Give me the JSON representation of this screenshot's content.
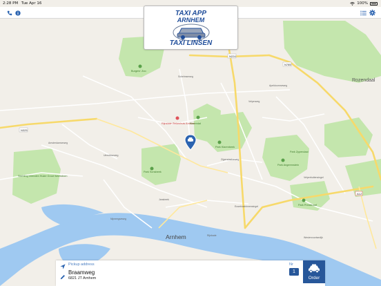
{
  "status_bar": {
    "time": "2:28 PM",
    "date": "Tue Apr 16",
    "battery_percent": "100%",
    "battery_level": 1.0
  },
  "nav_bar": {
    "left_icons": [
      "phone-icon",
      "info-icon"
    ],
    "right_icons": [
      "list-icon",
      "gear-icon"
    ],
    "accent_color": "#2b63b0"
  },
  "logo": {
    "line1": "TAXI APP",
    "line2": "ARNHEM",
    "line3": "TAXI LINSEN",
    "color": "#1f4d9a"
  },
  "map": {
    "city_label": "Arnhem",
    "district_label": "Rozendaal",
    "road_labels": [
      "N224",
      "N785",
      "N325",
      "N784",
      "Velperweg",
      "Zijpendaalseweg",
      "Apeldoornseweg",
      "Schelmseweg",
      "Utrechtseweg",
      "Amsterdamseweg",
      "Nijmeegseweg",
      "Rijnkade",
      "Eusebiusbinnensingel",
      "Velperbuitensingel",
      "Jansbeek",
      "Westervoortsedijk"
    ],
    "poi_labels": [
      "Burgers' Zoo",
      "Rijnstate Ziekenhuis Arnhem",
      "Klarendal",
      "Park Klarenbeek",
      "Park Sonsbeek",
      "Park Angerenstein",
      "Park Presikhaaf",
      "Park Zypendaal",
      "Stichting Vrienden Huize Groot Warnsborn"
    ],
    "colors": {
      "background": "#f2efe9",
      "park": "#bfe3a8",
      "water": "#9fc9f1",
      "road_major": "#f7d96a",
      "road_minor": "#ffffff"
    }
  },
  "pickup": {
    "label": "Pickup address",
    "street": "Braamweg",
    "postal": "6821 JT Arnhem"
  },
  "nr": {
    "label": "Nr",
    "value": "1"
  },
  "order": {
    "label": "Order",
    "color": "#27579a"
  }
}
